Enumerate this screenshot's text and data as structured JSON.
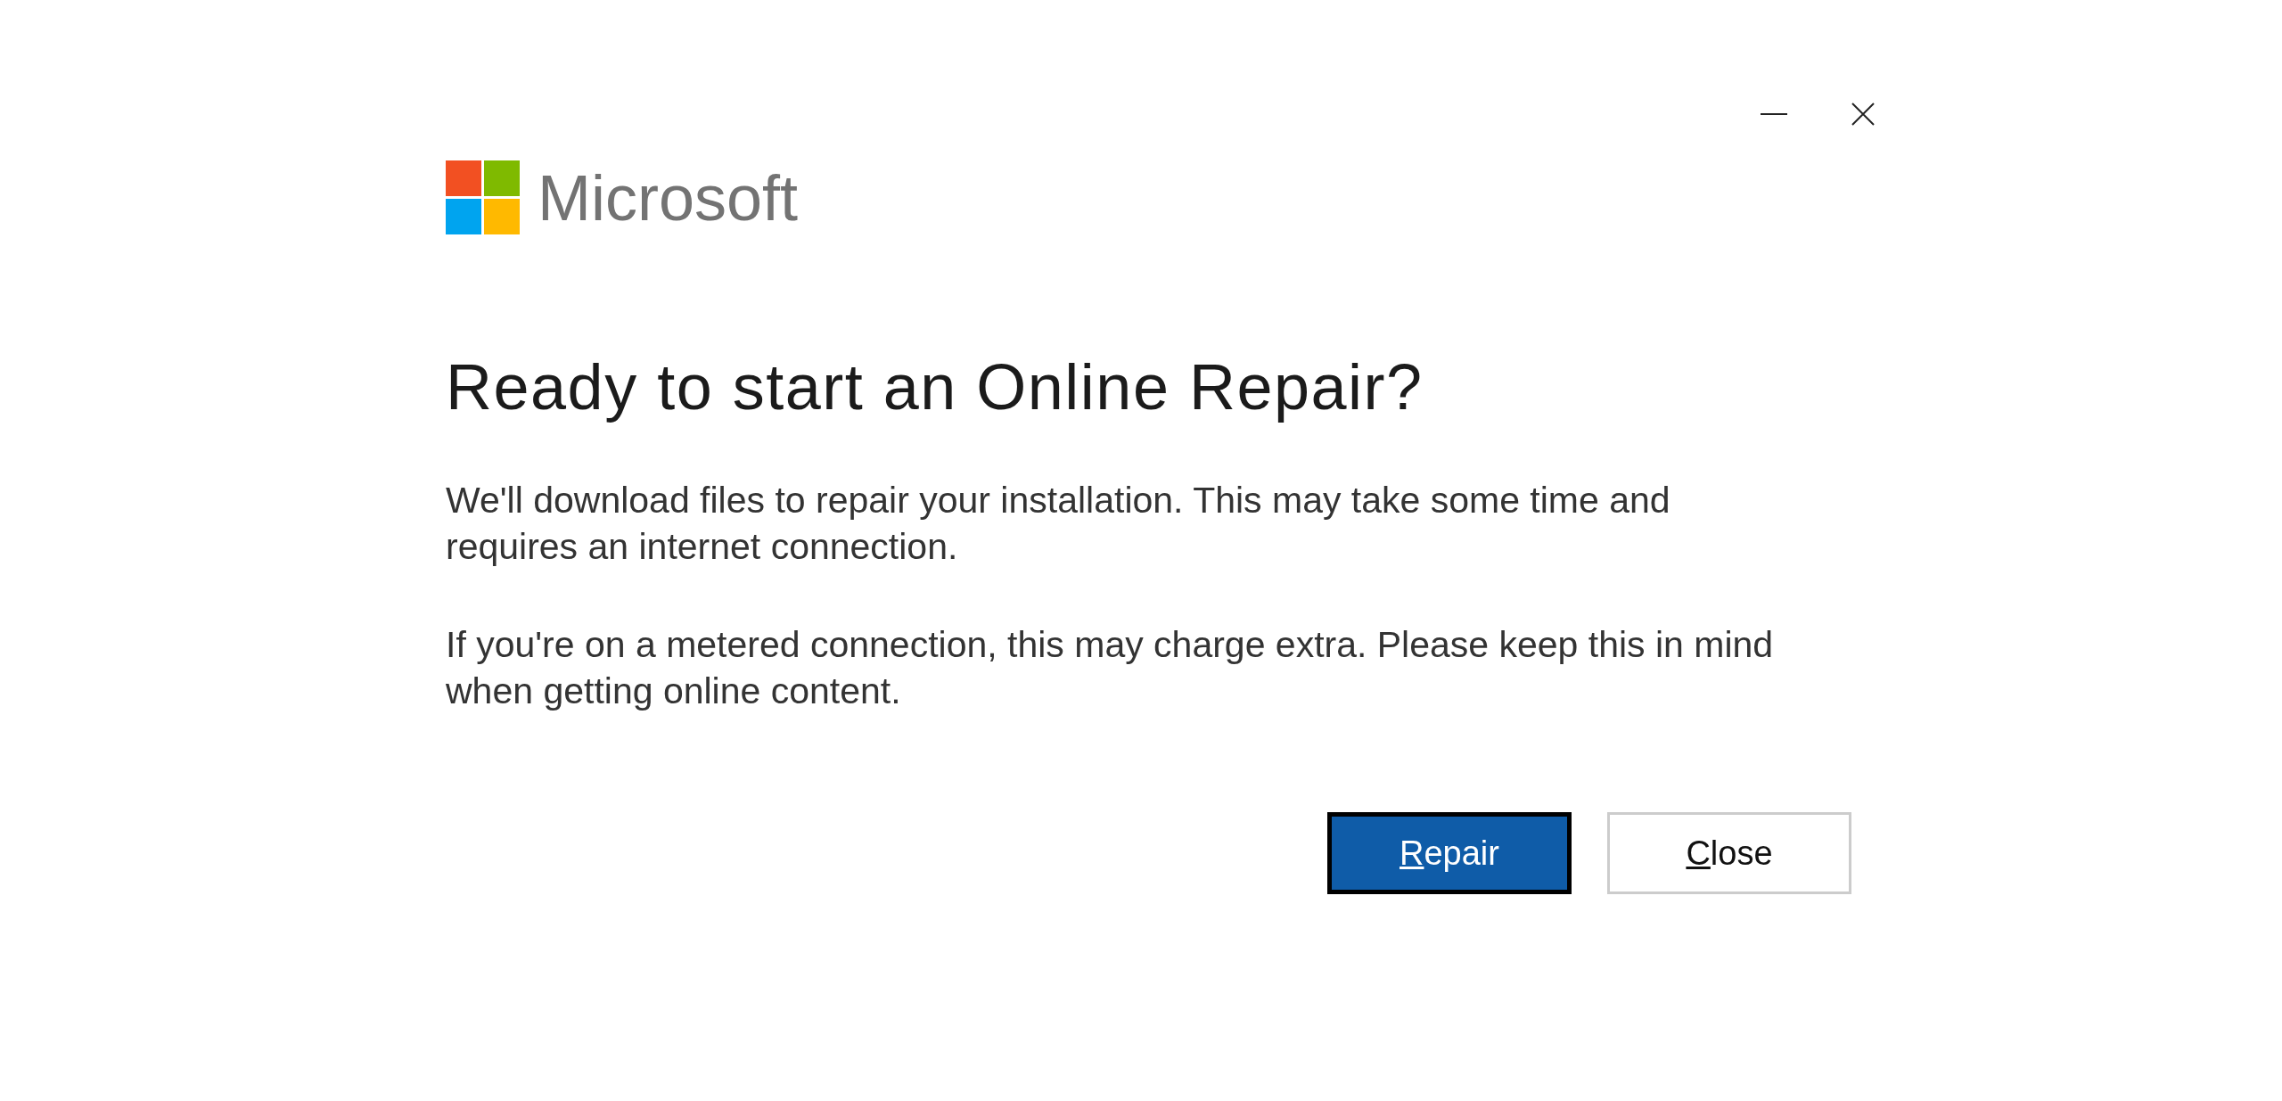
{
  "window": {
    "controls": [
      {
        "kind": "minimize"
      },
      {
        "kind": "close"
      }
    ]
  },
  "brand": {
    "name": "Microsoft"
  },
  "heading": "Ready to start an Online Repair?",
  "paragraphs": [
    "We'll download files to repair your installation. This may take some time and requires an internet connection.",
    "If you're on a metered connection, this may charge extra. Please keep this in mind when getting online content."
  ],
  "buttons": [
    {
      "label": "Repair",
      "default": true
    },
    {
      "label": "Close",
      "default": false
    }
  ]
}
